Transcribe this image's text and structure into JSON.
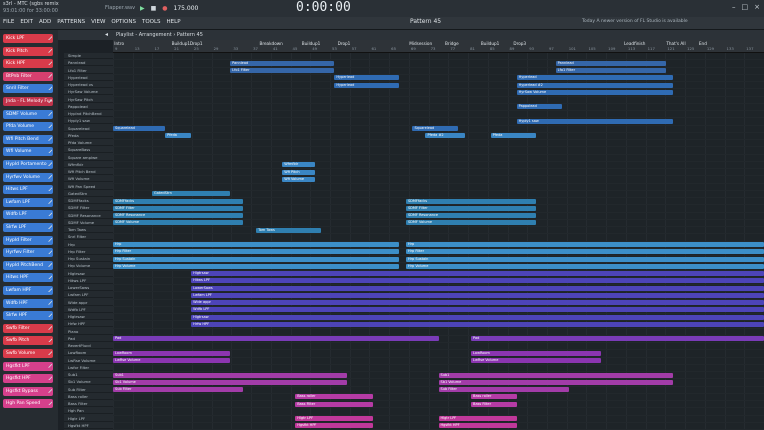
{
  "window": {
    "title": "s3rl - MTC (sgbs remix",
    "subtitle": "93:01:00 for 33:00:00",
    "hint": "Flapper.wav"
  },
  "menu": [
    "FILE",
    "EDIT",
    "ADD",
    "PATTERNS",
    "VIEW",
    "OPTIONS",
    "TOOLS",
    "HELP"
  ],
  "transport": {
    "tempo": "175.000",
    "time": "0:00:00",
    "pattern": "Pattern 45"
  },
  "notice": "Today  A newer version of FL Studio is available",
  "playlist": {
    "title": "Playlist - Arrangement › Pattern 45"
  },
  "markers": [
    {
      "label": "Intro",
      "pos": 0.002
    },
    {
      "label": "Buildup1",
      "pos": 0.09
    },
    {
      "label": "Drop1",
      "pos": 0.118
    },
    {
      "label": "Breakdown",
      "pos": 0.225
    },
    {
      "label": "Buildup1",
      "pos": 0.29
    },
    {
      "label": "Drop1",
      "pos": 0.345
    },
    {
      "label": "Midsession",
      "pos": 0.455
    },
    {
      "label": "Bridge",
      "pos": 0.51
    },
    {
      "label": "Buildup1",
      "pos": 0.565
    },
    {
      "label": "Drop3",
      "pos": 0.615
    },
    {
      "label": "Leadfinish",
      "pos": 0.785
    },
    {
      "label": "That's All",
      "pos": 0.85
    },
    {
      "label": "End",
      "pos": 0.9
    }
  ],
  "ruler_ticks": [
    "9",
    "13",
    "17",
    "21",
    "25",
    "29",
    "33",
    "37",
    "41",
    "45",
    "49",
    "53",
    "57",
    "61",
    "65",
    "69",
    "73",
    "77",
    "81",
    "85",
    "89",
    "93",
    "97",
    "101",
    "105",
    "109",
    "113",
    "117",
    "121",
    "125",
    "129",
    "133",
    "137"
  ],
  "sidebar": [
    {
      "label": "Kick LPF",
      "color": "#d93b4a"
    },
    {
      "label": "Kick Pitch",
      "color": "#d93b4a"
    },
    {
      "label": "Kick HPF",
      "color": "#d93b4a"
    },
    {
      "label": "BtPnb Filter",
      "color": "#d6406f"
    },
    {
      "label": "Snril Filter",
      "color": "#3a7bd5"
    },
    {
      "label": "Jnda - FL Melody Fun",
      "color": "#c2334b"
    },
    {
      "label": "SDMF Volume",
      "color": "#3a7bd5"
    },
    {
      "label": "Pfda Volume",
      "color": "#3a7bd5"
    },
    {
      "label": "Wfi Pitch Bend",
      "color": "#3a7bd5"
    },
    {
      "label": "Wfi Volume",
      "color": "#3a7bd5"
    },
    {
      "label": "Hypld Portamento",
      "color": "#3a7bd5"
    },
    {
      "label": "Hyrfwv Volume",
      "color": "#3a7bd5"
    },
    {
      "label": "Hitws LPF",
      "color": "#3a7bd5"
    },
    {
      "label": "Lwfam LPF",
      "color": "#3a7bd5"
    },
    {
      "label": "Wdfb LPF",
      "color": "#3a7bd5"
    },
    {
      "label": "Slrfw LPF",
      "color": "#3a7bd5"
    },
    {
      "label": "Hypld Filter",
      "color": "#3a7bd5"
    },
    {
      "label": "Hyrfwv Filter",
      "color": "#3a7bd5"
    },
    {
      "label": "Hypld PitchBend",
      "color": "#3a7bd5"
    },
    {
      "label": "Hitws HPF",
      "color": "#3a7bd5"
    },
    {
      "label": "Lwfam HPF",
      "color": "#3a7bd5"
    },
    {
      "label": "Wdfb HPF",
      "color": "#3a7bd5"
    },
    {
      "label": "Slrfw HPF",
      "color": "#3a7bd5"
    },
    {
      "label": "Swfb Filter",
      "color": "#d93b4a"
    },
    {
      "label": "Swfb Pitch",
      "color": "#d93b4a"
    },
    {
      "label": "Swfb Volume",
      "color": "#d93b4a"
    },
    {
      "label": "Hgsfkt LPF",
      "color": "#d6408c"
    },
    {
      "label": "Hgsfkt HPF",
      "color": "#d6408c"
    },
    {
      "label": "Hgsfkt Bypass",
      "color": "#d6408c"
    },
    {
      "label": "Hgh Pan Speed",
      "color": "#d6408c"
    }
  ],
  "track_names": [
    "Simple",
    "Pannlead",
    "Lfo1 Filter",
    "Hyperlead",
    "Hyperlead vs",
    "HyrSaw Volume",
    "HyrSaw Pitch",
    "Pappolead",
    "Hyplnd PitchBend",
    "Hyply1 saw",
    "Squarelead",
    "Pfeda",
    "Pfda Volume",
    "SquareBass",
    "Square amplwe",
    "Wfmfldr",
    "Wfi Pitch Bend",
    "Wfi Volume",
    "Wfi Pan Speed",
    "GatedStrn",
    "SDMFfacks",
    "SDMF Filter",
    "SDMF Resonance",
    "SDMF Volume",
    "Tom Taws",
    "Snrl Filter",
    "Hrp",
    "Hrp Filter",
    "Hrp Sustain",
    "Hrp Volume",
    "Hlgtrsaw",
    "Hitws LPF",
    "LowerSaws",
    "Lwfam LPF",
    "Wide appr",
    "Wdfb LPF",
    "Hlgtrsaw",
    "Hrfw HPF",
    "Piano",
    "Pad",
    "RevertPlucd",
    "LowRoom",
    "LwRse Volume",
    "Lwfor Filter",
    "Sub1",
    "Sb1 Volume",
    "Sub Filter",
    "Bass roller",
    "Bass Filter",
    "Hgh Pan",
    "Hlgtr LPF",
    "Hgsfkt HPF"
  ],
  "clips": [
    {
      "row": 1,
      "start": 0.18,
      "len": 0.16,
      "label": "Pannlead",
      "color": "#3566a8"
    },
    {
      "row": 1,
      "start": 0.68,
      "len": 0.17,
      "label": "Pannlead",
      "color": "#3566a8"
    },
    {
      "row": 2,
      "start": 0.18,
      "len": 0.16,
      "label": "Lfo1 Filter",
      "color": "#3566a8"
    },
    {
      "row": 2,
      "start": 0.68,
      "len": 0.17,
      "label": "Lfo1 Filter",
      "color": "#3566a8"
    },
    {
      "row": 3,
      "start": 0.34,
      "len": 0.1,
      "label": "Hyperlead",
      "color": "#2f6bb3"
    },
    {
      "row": 3,
      "start": 0.62,
      "len": 0.24,
      "label": "Hyperlead",
      "color": "#2f6bb3"
    },
    {
      "row": 4,
      "start": 0.34,
      "len": 0.1,
      "label": "Hyperlead",
      "color": "#2f6bb3"
    },
    {
      "row": 4,
      "start": 0.62,
      "len": 0.24,
      "label": "Hyperlead #2",
      "color": "#2f6bb3"
    },
    {
      "row": 5,
      "start": 0.62,
      "len": 0.24,
      "label": "HyrSaw Volume",
      "color": "#2f6bb3"
    },
    {
      "row": 7,
      "start": 0.62,
      "len": 0.07,
      "label": "Pappolead",
      "color": "#2f6bb3"
    },
    {
      "row": 9,
      "start": 0.62,
      "len": 0.24,
      "label": "Hyply1 saw",
      "color": "#2f6bb3"
    },
    {
      "row": 10,
      "start": 0.0,
      "len": 0.08,
      "label": "Squarelead",
      "color": "#2f6bb3"
    },
    {
      "row": 10,
      "start": 0.46,
      "len": 0.07,
      "label": "Squarelead",
      "color": "#2f6bb3"
    },
    {
      "row": 11,
      "start": 0.08,
      "len": 0.04,
      "label": "Pfeda",
      "color": "#3a86c4"
    },
    {
      "row": 11,
      "start": 0.48,
      "len": 0.06,
      "label": "Pfeda #2",
      "color": "#3a86c4"
    },
    {
      "row": 11,
      "start": 0.58,
      "len": 0.07,
      "label": "Pfeda",
      "color": "#3a86c4"
    },
    {
      "row": 15,
      "start": 0.26,
      "len": 0.05,
      "label": "Wfmfldr",
      "color": "#3a86c4"
    },
    {
      "row": 16,
      "start": 0.26,
      "len": 0.05,
      "label": "Wfi Pitch",
      "color": "#3a86c4"
    },
    {
      "row": 17,
      "start": 0.26,
      "len": 0.05,
      "label": "Wfi Volume",
      "color": "#3a86c4"
    },
    {
      "row": 19,
      "start": 0.06,
      "len": 0.12,
      "label": "GatedStrn",
      "color": "#2f7fb0"
    },
    {
      "row": 20,
      "start": 0.0,
      "len": 0.2,
      "label": "SDMFfacks",
      "color": "#2f7fb0"
    },
    {
      "row": 20,
      "start": 0.45,
      "len": 0.2,
      "label": "SDMFfacks",
      "color": "#2f7fb0"
    },
    {
      "row": 21,
      "start": 0.0,
      "len": 0.2,
      "label": "SDMF Filter",
      "color": "#2f7fb0"
    },
    {
      "row": 21,
      "start": 0.45,
      "len": 0.2,
      "label": "SDMF Filter",
      "color": "#2f7fb0"
    },
    {
      "row": 22,
      "start": 0.0,
      "len": 0.2,
      "label": "SDMF Resonance",
      "color": "#2f7fb0"
    },
    {
      "row": 22,
      "start": 0.45,
      "len": 0.2,
      "label": "SDMF Resonance",
      "color": "#2f7fb0"
    },
    {
      "row": 23,
      "start": 0.0,
      "len": 0.2,
      "label": "SDMF Volume",
      "color": "#2f7fb0"
    },
    {
      "row": 23,
      "start": 0.45,
      "len": 0.2,
      "label": "SDMF Volume",
      "color": "#2f7fb0"
    },
    {
      "row": 24,
      "start": 0.22,
      "len": 0.1,
      "label": "Tom Taws",
      "color": "#2f7fb0"
    },
    {
      "row": 26,
      "start": 0.0,
      "len": 0.44,
      "label": "Hrp",
      "color": "#3c8fc8"
    },
    {
      "row": 26,
      "start": 0.45,
      "len": 0.55,
      "label": "Hrp",
      "color": "#3c8fc8"
    },
    {
      "row": 27,
      "start": 0.0,
      "len": 0.44,
      "label": "Hrp Filter",
      "color": "#3c8fc8"
    },
    {
      "row": 27,
      "start": 0.45,
      "len": 0.55,
      "label": "Hrp Filter",
      "color": "#3c8fc8"
    },
    {
      "row": 28,
      "start": 0.0,
      "len": 0.44,
      "label": "Hrp Sustain",
      "color": "#3c8fc8"
    },
    {
      "row": 28,
      "start": 0.45,
      "len": 0.55,
      "label": "Hrp Sustain",
      "color": "#3c8fc8"
    },
    {
      "row": 29,
      "start": 0.0,
      "len": 0.44,
      "label": "Hrp Volume",
      "color": "#3c8fc8"
    },
    {
      "row": 29,
      "start": 0.45,
      "len": 0.55,
      "label": "Hrp Volume",
      "color": "#3c8fc8"
    },
    {
      "row": 30,
      "start": 0.12,
      "len": 0.88,
      "label": "Hlgtrsaw",
      "color": "#4d44b8"
    },
    {
      "row": 31,
      "start": 0.12,
      "len": 0.88,
      "label": "Hitws LPF",
      "color": "#4d44b8"
    },
    {
      "row": 32,
      "start": 0.12,
      "len": 0.88,
      "label": "LowerSaws",
      "color": "#4d44b8"
    },
    {
      "row": 33,
      "start": 0.12,
      "len": 0.88,
      "label": "Lwfam LPF",
      "color": "#4d44b8"
    },
    {
      "row": 34,
      "start": 0.12,
      "len": 0.88,
      "label": "Wide appr",
      "color": "#4d44b8"
    },
    {
      "row": 35,
      "start": 0.12,
      "len": 0.88,
      "label": "Wdfb LPF",
      "color": "#4d44b8"
    },
    {
      "row": 36,
      "start": 0.12,
      "len": 0.88,
      "label": "Hlgtrsaw",
      "color": "#4d44b8"
    },
    {
      "row": 37,
      "start": 0.12,
      "len": 0.88,
      "label": "Hrfw HPF",
      "color": "#4d44b8"
    },
    {
      "row": 39,
      "start": 0.0,
      "len": 0.5,
      "label": "Pad",
      "color": "#7a3cb8"
    },
    {
      "row": 39,
      "start": 0.55,
      "len": 0.45,
      "label": "Pad",
      "color": "#7a3cb8"
    },
    {
      "row": 41,
      "start": 0.0,
      "len": 0.18,
      "label": "LowRoom",
      "color": "#8b35b0"
    },
    {
      "row": 41,
      "start": 0.55,
      "len": 0.2,
      "label": "LowRoom",
      "color": "#8b35b0"
    },
    {
      "row": 42,
      "start": 0.0,
      "len": 0.18,
      "label": "LwRse Volume",
      "color": "#8b35b0"
    },
    {
      "row": 42,
      "start": 0.55,
      "len": 0.2,
      "label": "LwRse Volume",
      "color": "#8b35b0"
    },
    {
      "row": 44,
      "start": 0.0,
      "len": 0.36,
      "label": "Sub1",
      "color": "#a23ca8"
    },
    {
      "row": 44,
      "start": 0.5,
      "len": 0.36,
      "label": "Sub1",
      "color": "#a23ca8"
    },
    {
      "row": 45,
      "start": 0.0,
      "len": 0.36,
      "label": "Sb1 Volume",
      "color": "#a23ca8"
    },
    {
      "row": 45,
      "start": 0.5,
      "len": 0.36,
      "label": "Sb1 Volume",
      "color": "#a23ca8"
    },
    {
      "row": 46,
      "start": 0.0,
      "len": 0.2,
      "label": "Sub Filter",
      "color": "#a23ca8"
    },
    {
      "row": 46,
      "start": 0.5,
      "len": 0.2,
      "label": "Sub Filter",
      "color": "#a23ca8"
    },
    {
      "row": 47,
      "start": 0.28,
      "len": 0.12,
      "label": "Bass roller",
      "color": "#b53ba5"
    },
    {
      "row": 47,
      "start": 0.55,
      "len": 0.07,
      "label": "Bass roller",
      "color": "#b53ba5"
    },
    {
      "row": 48,
      "start": 0.28,
      "len": 0.12,
      "label": "Bass Filter",
      "color": "#b53ba5"
    },
    {
      "row": 48,
      "start": 0.55,
      "len": 0.07,
      "label": "Bass Filter",
      "color": "#b53ba5"
    },
    {
      "row": 50,
      "start": 0.28,
      "len": 0.12,
      "label": "Hlgtr LPF",
      "color": "#c0389a"
    },
    {
      "row": 50,
      "start": 0.5,
      "len": 0.12,
      "label": "Hlgtr LPF",
      "color": "#c0389a"
    },
    {
      "row": 51,
      "start": 0.28,
      "len": 0.12,
      "label": "Hgsfkt HPF",
      "color": "#c0389a"
    },
    {
      "row": 51,
      "start": 0.5,
      "len": 0.12,
      "label": "Hgsfkt HPF",
      "color": "#c0389a"
    }
  ]
}
